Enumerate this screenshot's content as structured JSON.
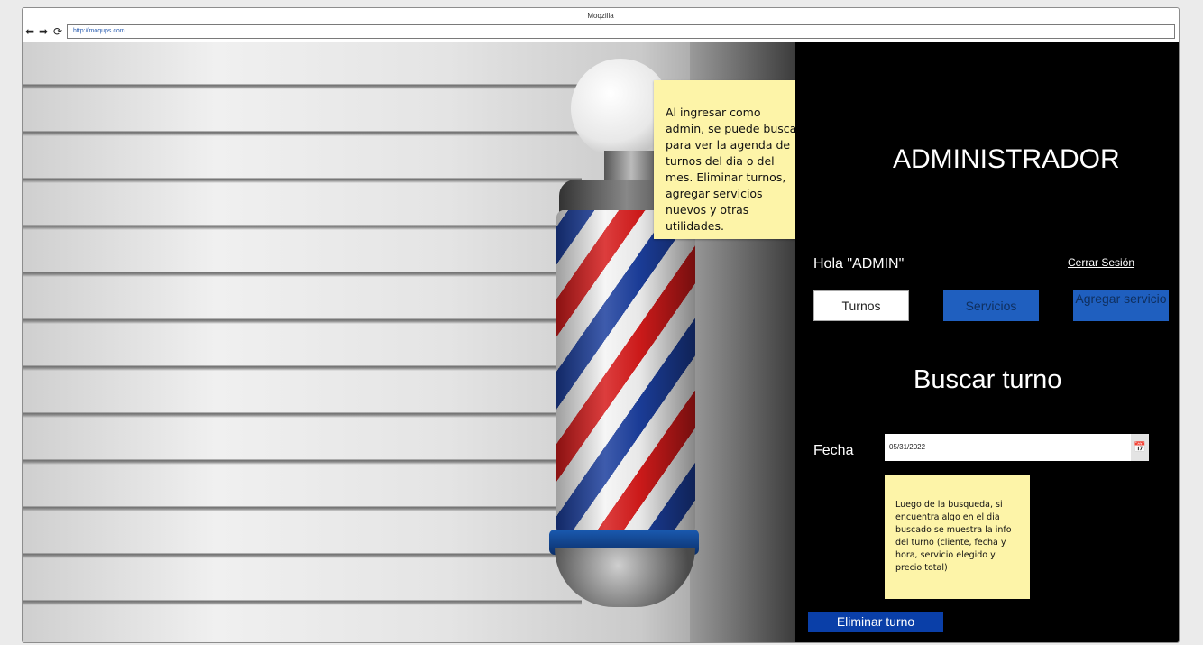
{
  "browser": {
    "title": "Moqzilla",
    "url": "http://moqups.com",
    "back_icon": "back-arrow-icon",
    "forward_icon": "forward-arrow-icon",
    "reload_icon": "reload-icon"
  },
  "notes": {
    "top": "Al ingresar como admin, se puede buscar para ver la agenda de turnos del dia o del mes. Eliminar turnos, agregar servicios nuevos y otras utilidades.",
    "bottom": "Luego de la busqueda, si encuentra algo en el dia buscado se muestra la info del turno (cliente, fecha y hora, servicio elegido y precio total)"
  },
  "panel": {
    "title": "ADMINISTRADOR",
    "greeting": "Hola \"ADMIN\"",
    "logout_label": "Cerrar Sesión",
    "buttons": {
      "turnos": "Turnos",
      "servicios": "Servicios",
      "agregar": "Agregar servicio"
    },
    "search_title": "Buscar turno",
    "date_label": "Fecha",
    "date_value": "05/31/2022",
    "calendar_icon": "calendar-icon",
    "delete_label": "Eliminar turno"
  },
  "colors": {
    "panel_bg": "#000000",
    "button_blue": "#1f5fbf",
    "delete_blue": "#0a3fa8",
    "sticky_yellow": "#fdf4a8"
  }
}
